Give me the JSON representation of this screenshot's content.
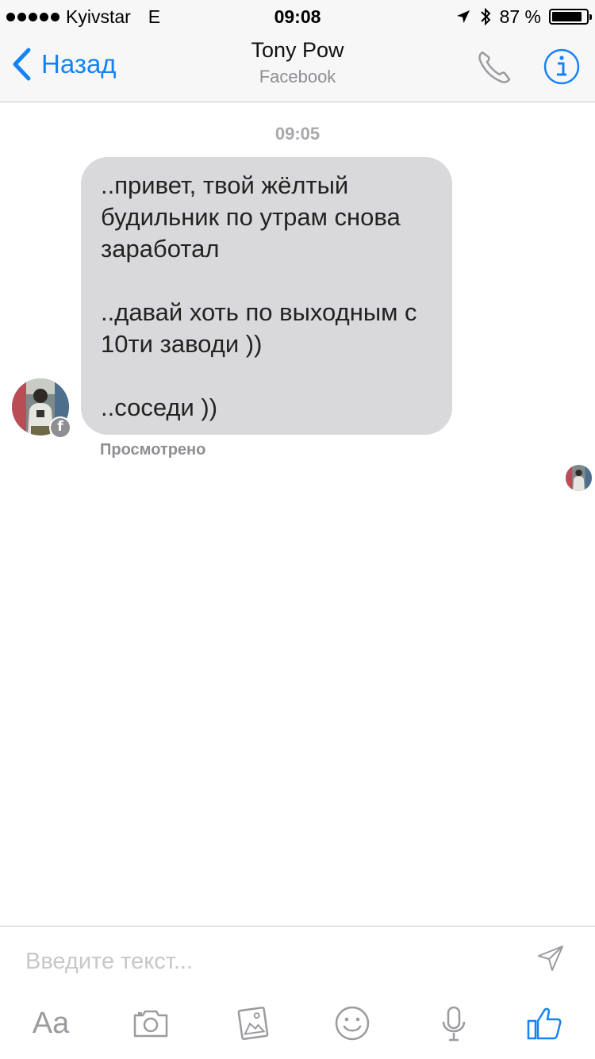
{
  "status_bar": {
    "carrier": "Kyivstar",
    "network": "E",
    "time": "09:08",
    "battery_text": "87 %",
    "battery_level": 0.87
  },
  "nav": {
    "back_label": "Назад",
    "title": "Tony Pow",
    "subtitle": "Facebook"
  },
  "conversation": {
    "timestamp": "09:05",
    "message": "..привет, твой жёлтый\nбудильник по утрам снова\nзаработал\n\n..давай хоть по выходным с\n10ти заводи ))\n\n..соседи ))",
    "seen_label": "Просмотрено"
  },
  "composer": {
    "placeholder": "Введите текст...",
    "aa_label": "Aa"
  },
  "colors": {
    "accent": "#1583f5",
    "bubble": "#d9d9db",
    "muted": "#8e8e93"
  },
  "icons": {
    "back": "chevron-left-icon",
    "call": "phone-icon",
    "info": "info-icon",
    "send": "send-icon",
    "camera": "camera-icon",
    "gallery": "photo-icon",
    "emoji": "smiley-icon",
    "mic": "microphone-icon",
    "like": "thumbs-up-icon"
  }
}
